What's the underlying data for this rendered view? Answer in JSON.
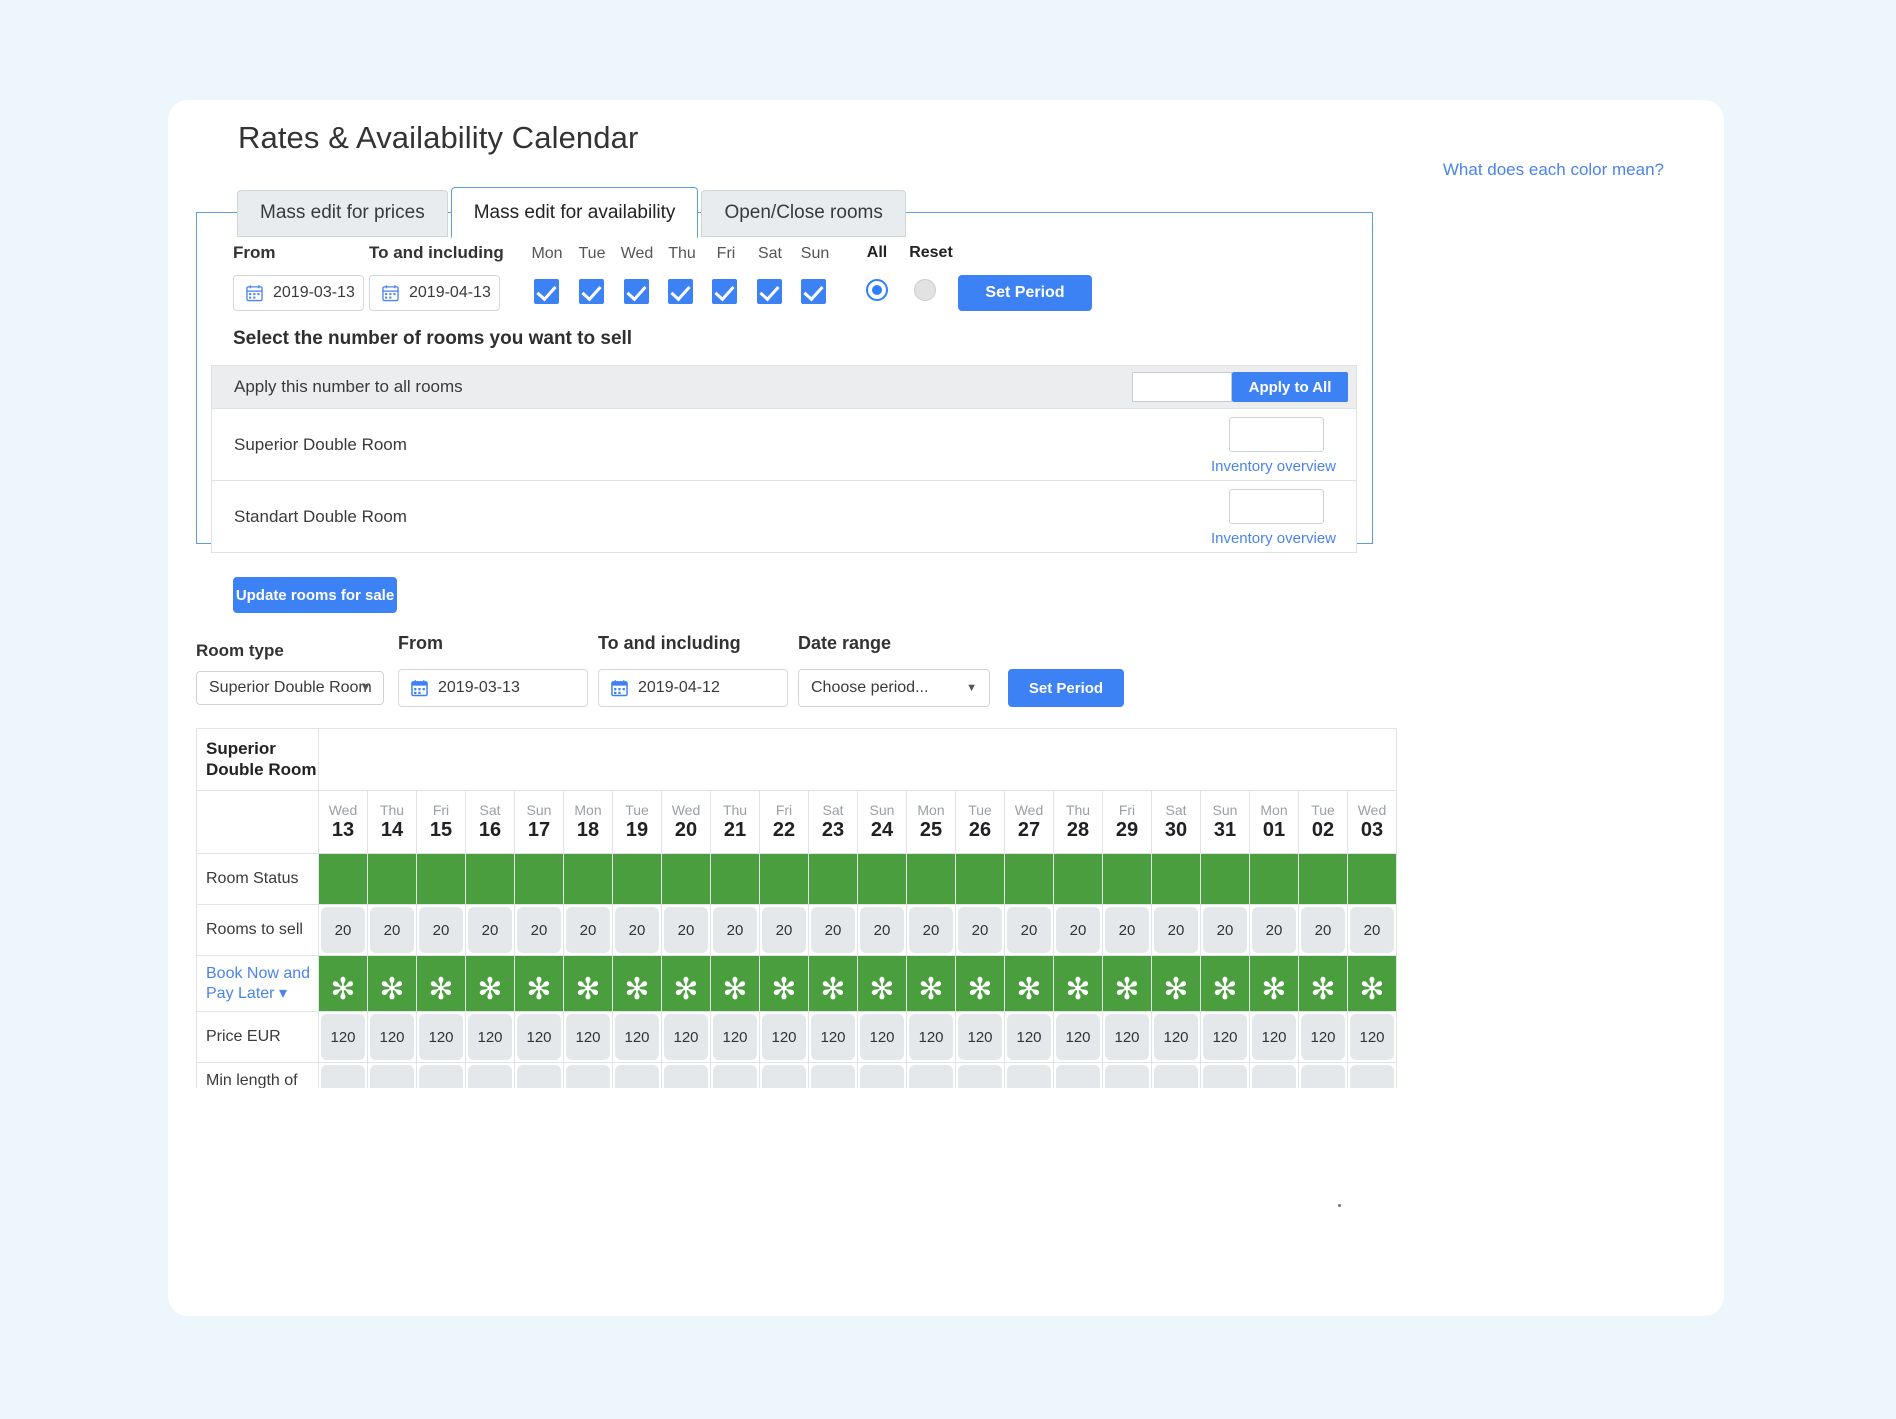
{
  "page": {
    "title": "Rates & Availability Calendar",
    "color_legend_link": "What does each color mean?"
  },
  "tabs": [
    {
      "label": "Mass edit for prices",
      "active": false
    },
    {
      "label": "Mass edit for availability",
      "active": true
    },
    {
      "label": "Open/Close rooms",
      "active": false
    }
  ],
  "mass_edit": {
    "from_label": "From",
    "from_value": "2019-03-13",
    "to_label": "To and including",
    "to_value": "2019-04-13",
    "weekdays": [
      "Mon",
      "Tue",
      "Wed",
      "Thu",
      "Fri",
      "Sat",
      "Sun"
    ],
    "weekday_checked": [
      true,
      true,
      true,
      true,
      true,
      true,
      true
    ],
    "all_label": "All",
    "reset_label": "Reset",
    "all_selected": true,
    "reset_selected": false,
    "set_period_label": "Set Period",
    "section_title": "Select the number of rooms you want to sell",
    "apply_all_label": "Apply this number to all rooms",
    "apply_all_value": "",
    "apply_all_button": "Apply to All",
    "rooms": [
      {
        "name": "Superior Double Room",
        "value": "",
        "link": "Inventory overview"
      },
      {
        "name": "Standart Double Room",
        "value": "",
        "link": "Inventory overview"
      }
    ],
    "update_button": "Update rooms for sale"
  },
  "filters": {
    "room_type_label": "Room type",
    "room_type_value": "Superior Double Room",
    "from_label": "From",
    "from_value": "2019-03-13",
    "to_label": "To and including",
    "to_value": "2019-04-12",
    "date_range_label": "Date range",
    "date_range_value": "Choose period...",
    "set_period_label": "Set Period"
  },
  "calendar": {
    "room_type_title": "Superior Double Room",
    "days": [
      {
        "dow": "Wed",
        "num": "13"
      },
      {
        "dow": "Thu",
        "num": "14"
      },
      {
        "dow": "Fri",
        "num": "15"
      },
      {
        "dow": "Sat",
        "num": "16"
      },
      {
        "dow": "Sun",
        "num": "17"
      },
      {
        "dow": "Mon",
        "num": "18"
      },
      {
        "dow": "Tue",
        "num": "19"
      },
      {
        "dow": "Wed",
        "num": "20"
      },
      {
        "dow": "Thu",
        "num": "21"
      },
      {
        "dow": "Fri",
        "num": "22"
      },
      {
        "dow": "Sat",
        "num": "23"
      },
      {
        "dow": "Sun",
        "num": "24"
      },
      {
        "dow": "Mon",
        "num": "25"
      },
      {
        "dow": "Tue",
        "num": "26"
      },
      {
        "dow": "Wed",
        "num": "27"
      },
      {
        "dow": "Thu",
        "num": "28"
      },
      {
        "dow": "Fri",
        "num": "29"
      },
      {
        "dow": "Sat",
        "num": "30"
      },
      {
        "dow": "Sun",
        "num": "31"
      },
      {
        "dow": "Mon",
        "num": "01"
      },
      {
        "dow": "Tue",
        "num": "02"
      },
      {
        "dow": "Wed",
        "num": "03"
      }
    ],
    "rows": {
      "room_status": {
        "label": "Room Status",
        "open": true
      },
      "rooms_to_sell": {
        "label": "Rooms to sell",
        "values": [
          "20",
          "20",
          "20",
          "20",
          "20",
          "20",
          "20",
          "20",
          "20",
          "20",
          "20",
          "20",
          "20",
          "20",
          "20",
          "20",
          "20",
          "20",
          "20",
          "20",
          "20",
          "20"
        ]
      },
      "rate_plan": {
        "label": "Book Now and Pay Later",
        "glyph": "✻"
      },
      "price": {
        "label": "Price EUR",
        "values": [
          "120",
          "120",
          "120",
          "120",
          "120",
          "120",
          "120",
          "120",
          "120",
          "120",
          "120",
          "120",
          "120",
          "120",
          "120",
          "120",
          "120",
          "120",
          "120",
          "120",
          "120",
          "120"
        ]
      },
      "min_stay": {
        "label": "Min length of stay",
        "values": [
          "",
          "",
          "",
          "",
          "",
          "",
          "",
          "",
          "",
          "",
          "",
          "",
          "",
          "",
          "",
          "",
          "",
          "",
          "",
          "",
          "",
          ""
        ]
      }
    }
  },
  "colors": {
    "accent_blue": "#3d82f4",
    "link_blue": "#4a84e8",
    "status_green": "#4a9e3e",
    "page_bg": "#edf6fa"
  }
}
